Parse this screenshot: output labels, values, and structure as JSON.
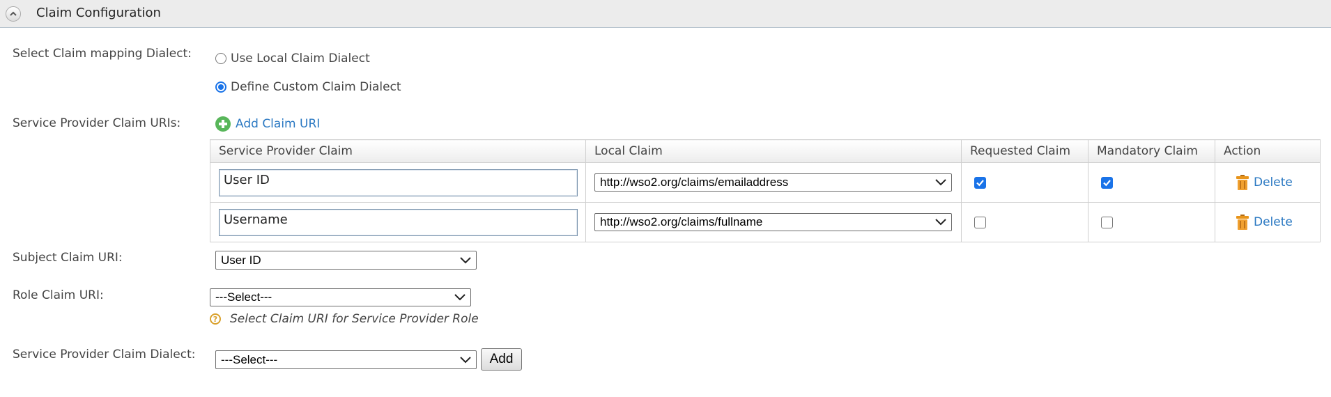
{
  "section": {
    "title": "Claim Configuration",
    "collapse_icon": "chevron-up-icon"
  },
  "dialect": {
    "label": "Select Claim mapping Dialect:",
    "options": [
      {
        "label": "Use Local Claim Dialect",
        "selected": false
      },
      {
        "label": "Define Custom Claim Dialect",
        "selected": true
      }
    ]
  },
  "sp_claims": {
    "label": "Service Provider Claim URIs:",
    "add_link": "Add Claim URI",
    "columns": [
      "Service Provider Claim",
      "Local Claim",
      "Requested Claim",
      "Mandatory Claim",
      "Action"
    ],
    "rows": [
      {
        "sp_claim": "User ID",
        "local_claim": "http://wso2.org/claims/emailaddress",
        "requested": true,
        "mandatory": true,
        "action": "Delete"
      },
      {
        "sp_claim": "Username",
        "local_claim": "http://wso2.org/claims/fullname",
        "requested": false,
        "mandatory": false,
        "action": "Delete"
      }
    ]
  },
  "subject_claim": {
    "label": "Subject Claim URI:",
    "value": "User ID"
  },
  "role_claim": {
    "label": "Role Claim URI:",
    "value": "---Select---",
    "hint": "Select Claim URI for Service Provider Role"
  },
  "claim_dialect": {
    "label": "Service Provider Claim Dialect:",
    "value": "---Select---",
    "add_button": "Add"
  },
  "colors": {
    "accent": "#1a73e8",
    "link": "#2a78c2",
    "add_icon": "#58b65a",
    "hint_icon": "#d9a02b",
    "delete_icon": "#e8941a"
  }
}
